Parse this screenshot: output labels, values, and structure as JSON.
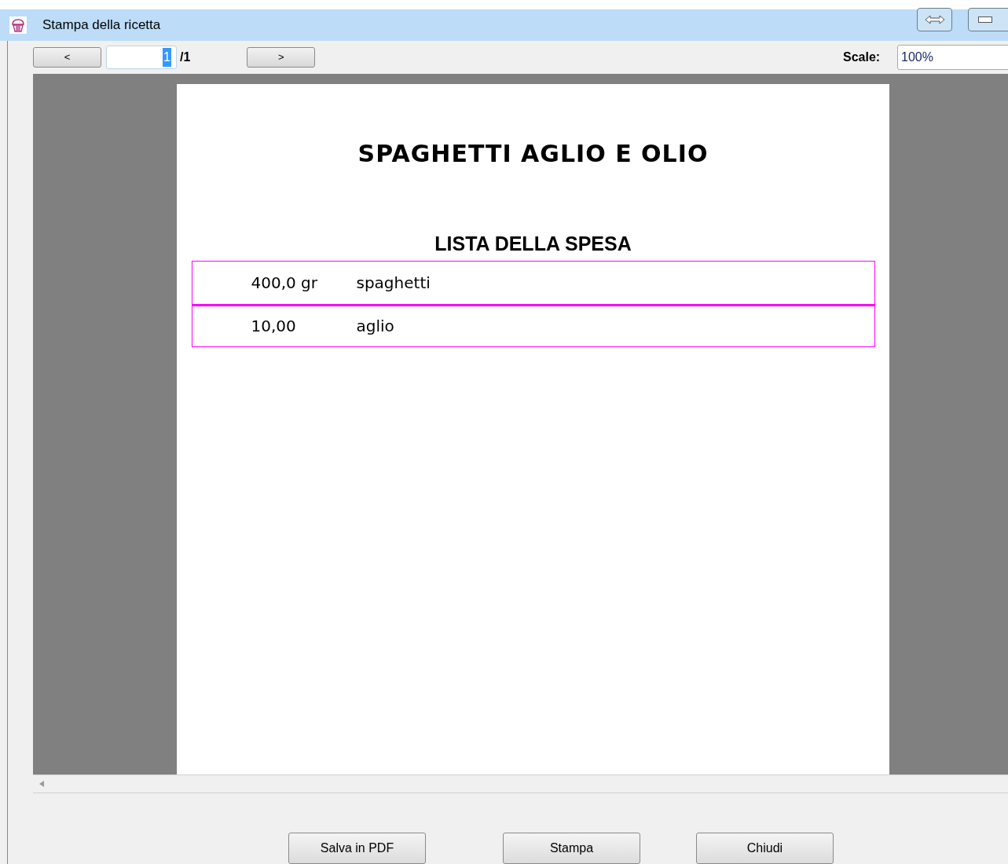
{
  "window": {
    "title": "Stampa della ricetta"
  },
  "toolbar": {
    "prev": "<",
    "page": "1",
    "page_total": "/1",
    "next": ">",
    "scale_label": "Scale:",
    "scale": "100%"
  },
  "document": {
    "title": "SPAGHETTI AGLIO E OLIO",
    "section": "LISTA DELLA SPESA",
    "rows": [
      {
        "quantity": "400,0 gr",
        "item": "spaghetti"
      },
      {
        "quantity": "10,00",
        "item": "aglio"
      }
    ]
  },
  "buttons": [
    "Salva in PDF",
    "Stampa",
    "Chiudi"
  ]
}
